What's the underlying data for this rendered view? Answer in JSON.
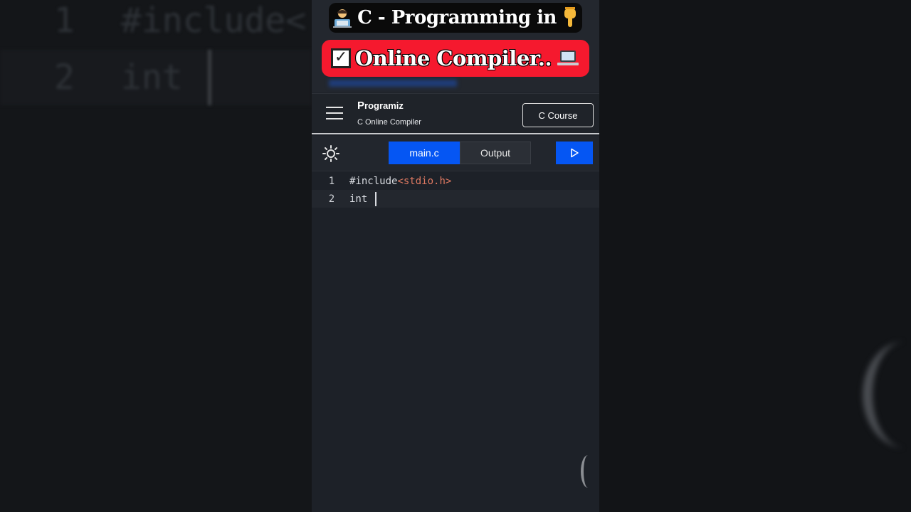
{
  "background": {
    "lines": [
      {
        "number": "1",
        "text": "#include<"
      },
      {
        "number": "2",
        "text": "int"
      }
    ]
  },
  "banner": {
    "line1_icon": "technologist-emoji",
    "line1_text": "C - Programming in",
    "line1_end_icon": "pointing-down-emoji",
    "line2_icon": "check-box-emoji",
    "line2_text": "Online Compiler..",
    "line2_end_icon": "laptop-emoji"
  },
  "header": {
    "brand": "rogramiz",
    "brand_initial": "P",
    "subtitle": "C Online Compiler",
    "course_button": "C Course",
    "menu_icon": "hamburger-menu-icon"
  },
  "toolbar": {
    "theme_icon": "sun-icon",
    "tabs": [
      {
        "label": "main.c",
        "active": true
      },
      {
        "label": "Output",
        "active": false
      }
    ],
    "run_icon": "play-icon"
  },
  "editor": {
    "lines": [
      {
        "number": "1",
        "code": "#include",
        "code_string": "<stdio.h>"
      },
      {
        "number": "2",
        "code": "int "
      }
    ]
  },
  "colors": {
    "accent": "#0556f3",
    "banner_red": "#f5192e",
    "editor_bg": "#1d2128",
    "string_color": "#e07a62"
  }
}
